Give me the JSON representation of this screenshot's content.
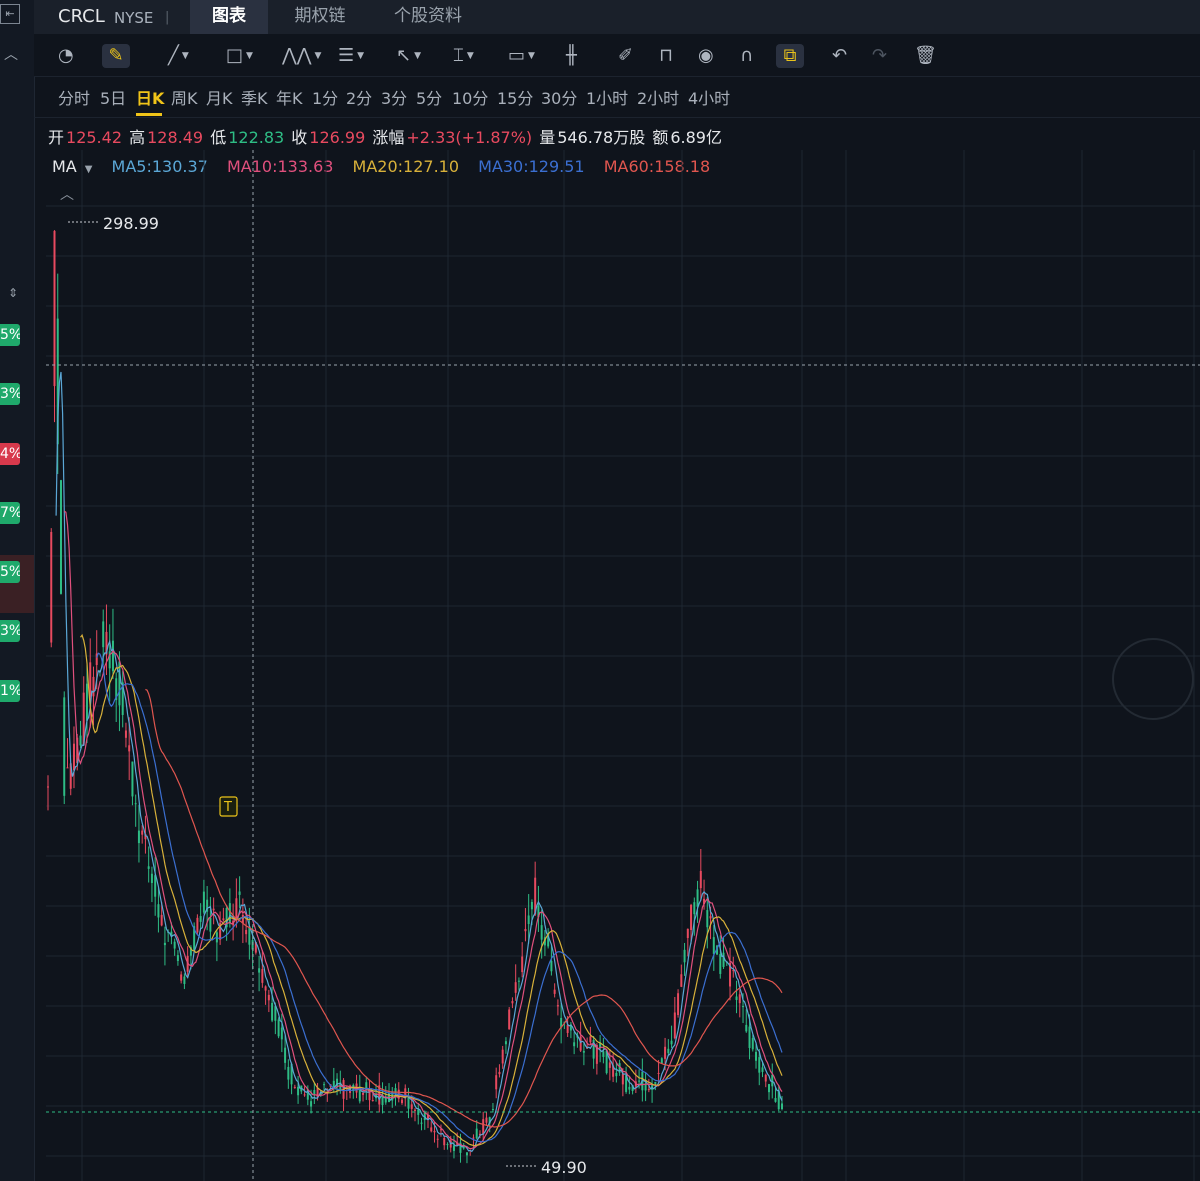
{
  "header": {
    "ticker": "CRCL",
    "exchange": "NYSE",
    "separator": "|",
    "tabs": [
      {
        "label": "图表",
        "active": true
      },
      {
        "label": "期权链",
        "active": false
      },
      {
        "label": "个股资料",
        "active": false
      }
    ]
  },
  "toolbar": {
    "tools": [
      "speedometer-icon",
      "pencil-edit-icon",
      "trend-line-icon",
      "rectangle-icon",
      "pattern-icon",
      "fib-icon",
      "arrow-icon",
      "measure-icon",
      "text-icon",
      "candle-icon",
      "brush-icon",
      "lock-icon",
      "eye-icon",
      "magnet-icon",
      "link-icon",
      "undo-icon",
      "redo-icon",
      "trash-icon"
    ]
  },
  "periods": [
    "分时",
    "5日",
    "日K",
    "周K",
    "月K",
    "季K",
    "年K",
    "1分",
    "2分",
    "3分",
    "5分",
    "10分",
    "15分",
    "30分",
    "1小时",
    "2小时",
    "4小时"
  ],
  "active_period": "日K",
  "quote": {
    "open_label": "开",
    "open": "125.42",
    "high_label": "高",
    "high": "128.49",
    "low_label": "低",
    "low": "122.83",
    "close_label": "收",
    "close": "126.99",
    "change_label": "涨幅",
    "change": "+2.33(+1.87%)",
    "volume_label": "量",
    "volume": "546.78万股",
    "amount_label": "额",
    "amount": "6.89亿"
  },
  "ma": {
    "label": "MA",
    "ma5": "MA5:130.37",
    "ma10": "MA10:133.63",
    "ma20": "MA20:127.10",
    "ma30": "MA30:129.51",
    "ma60": "MA60:158.18"
  },
  "colors": {
    "up": "#e84a5f",
    "down": "#2ebd85",
    "ma5": "#5ba7d6",
    "ma10": "#e0507d",
    "ma20": "#d8b13a",
    "ma30": "#3b6fd1",
    "ma60": "#e0564f",
    "active": "#f0c419"
  },
  "left_rail": {
    "badges": [
      "5%",
      "3%",
      "4%",
      "7%",
      "5%",
      "3%",
      "1%"
    ],
    "badge_colors": [
      "#1fa96b",
      "#1fa96b",
      "#d8394c",
      "#1fa96b",
      "#1fa96b",
      "#1fa96b",
      "#1fa96b"
    ]
  },
  "chart_data": {
    "type": "candlestick",
    "high_marker": "298.99",
    "low_marker": "49.90",
    "event_marker": "T",
    "price_range": [
      49.9,
      298.99
    ],
    "last_close": 126.99
  }
}
